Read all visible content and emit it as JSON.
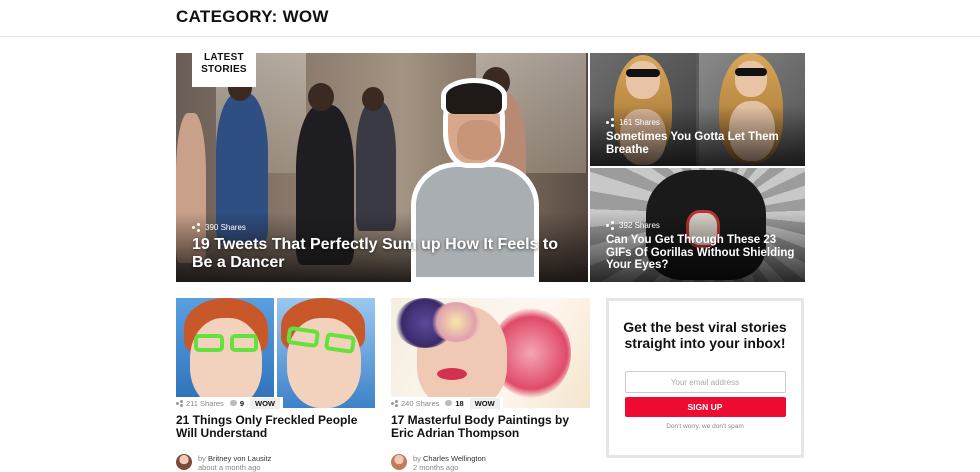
{
  "page": {
    "title": "CATEGORY: WOW"
  },
  "hero": {
    "badge": "LATEST STORIES",
    "shares": "390 Shares",
    "title": "19 Tweets That Perfectly Sum up How It Feels to Be a Dancer"
  },
  "side_stories": [
    {
      "shares": "161 Shares",
      "title": "Sometimes You Gotta Let Them Breathe"
    },
    {
      "shares": "392 Shares",
      "title": "Can You Get Through These 23 GIFs Of Gorillas Without Shielding Your Eyes?"
    }
  ],
  "cards": [
    {
      "shares": "211 Shares",
      "comments": "9",
      "tag": "WOW",
      "title": "21 Things Only Freckled People Will Understand",
      "author": "Britney von Lausitz",
      "date": "about a month ago",
      "by": "by"
    },
    {
      "shares": "240 Shares",
      "comments": "18",
      "tag": "WOW",
      "title": "17 Masterful Body Paintings by Eric Adrian Thompson",
      "author": "Charles Wellington",
      "date": "2 months ago",
      "by": "by"
    }
  ],
  "signup": {
    "title": "Get the best viral stories straight into your inbox!",
    "email_placeholder": "Your email address",
    "button": "SIGN UP",
    "note": "Don't worry, we don't spam"
  },
  "icons": {
    "share": "share-icon",
    "comment": "comment-icon"
  },
  "colors": {
    "accent": "#ee0b32",
    "text": "#111111",
    "muted": "#888888"
  }
}
